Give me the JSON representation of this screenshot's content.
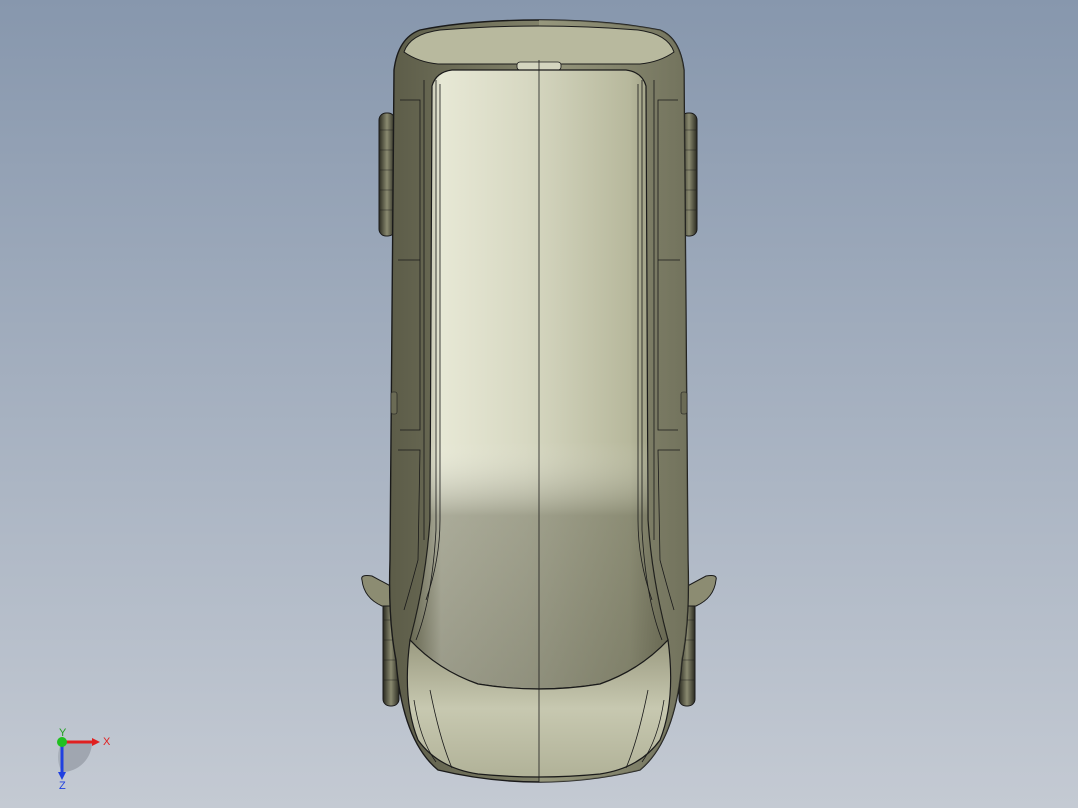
{
  "viewport": {
    "background_top": "#8797ad",
    "background_bottom": "#c4cad3",
    "model": "van-top-view",
    "body_color": "#c9c9b0",
    "edge_color": "#1a1a1a"
  },
  "triad": {
    "x_label": "X",
    "y_label": "Y",
    "z_label": "Z",
    "x_color": "#e02020",
    "y_color": "#20c020",
    "z_color": "#2040e0"
  }
}
